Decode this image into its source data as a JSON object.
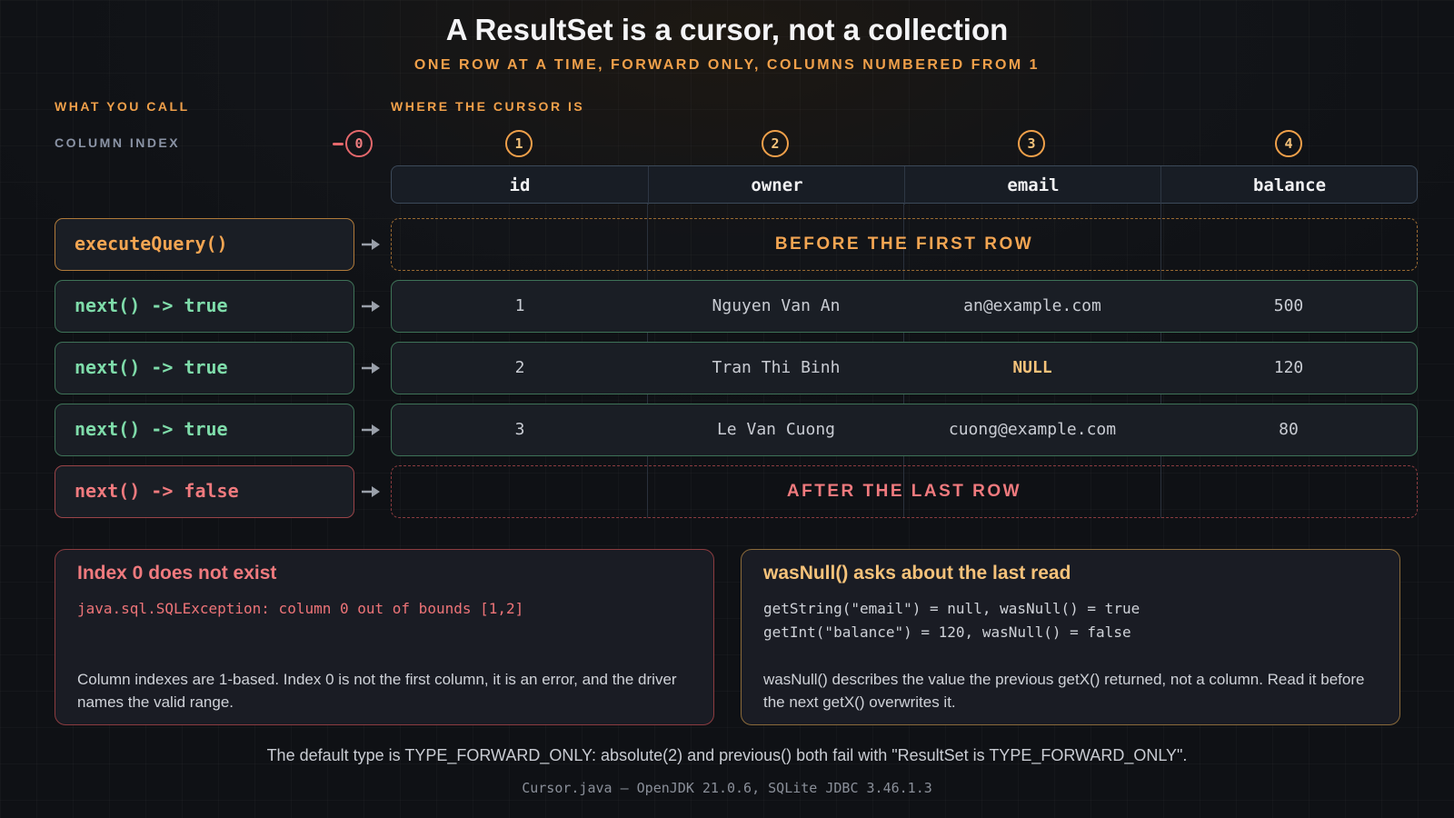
{
  "title": "A ResultSet is a cursor, not a collection",
  "subtitle": "ONE ROW AT A TIME, FORWARD ONLY, COLUMNS NUMBERED FROM 1",
  "labels": {
    "what_you_call": "WHAT YOU CALL",
    "where_cursor": "WHERE THE CURSOR IS",
    "column_index": "COLUMN INDEX"
  },
  "column_indexes": [
    "0",
    "1",
    "2",
    "3",
    "4"
  ],
  "columns": [
    "id",
    "owner",
    "email",
    "balance"
  ],
  "rows": [
    {
      "call": "executeQuery()",
      "kind": "state",
      "tone": "orange",
      "state": "BEFORE THE FIRST ROW"
    },
    {
      "call": "next() -> true",
      "kind": "data",
      "tone": "green",
      "cells": [
        "1",
        "Nguyen Van An",
        "an@example.com",
        "500"
      ]
    },
    {
      "call": "next() -> true",
      "kind": "data",
      "tone": "green",
      "cells": [
        "2",
        "Tran Thi Binh",
        "NULL",
        "120"
      ]
    },
    {
      "call": "next() -> true",
      "kind": "data",
      "tone": "green",
      "cells": [
        "3",
        "Le Van Cuong",
        "cuong@example.com",
        "80"
      ]
    },
    {
      "call": "next() -> false",
      "kind": "state",
      "tone": "red",
      "state": "AFTER THE LAST ROW"
    }
  ],
  "notes": {
    "left": {
      "title": "Index 0 does not exist",
      "code": "java.sql.SQLException: column 0 out of bounds [1,2]",
      "body": "Column indexes are 1-based. Index 0 is not the first column, it is an error, and the driver names the valid range."
    },
    "right": {
      "title": "wasNull() asks about the last read",
      "code_lines": [
        "getString(\"email\") = null, wasNull() = true",
        "getInt(\"balance\") = 120, wasNull() = false"
      ],
      "body": "wasNull() describes the value the previous getX() returned, not a column. Read it before the next getX() overwrites it."
    }
  },
  "footer": "The default type is TYPE_FORWARD_ONLY: absolute(2) and previous() both fail with \"ResultSet is TYPE_FORWARD_ONLY\".",
  "credit": "Cursor.java — OpenJDK 21.0.6, SQLite JDBC 3.46.1.3",
  "colors": {
    "accent": "#f0a04a",
    "success": "#7fdcaa",
    "error": "#f07a7e",
    "null_value": "#f5c27a"
  }
}
